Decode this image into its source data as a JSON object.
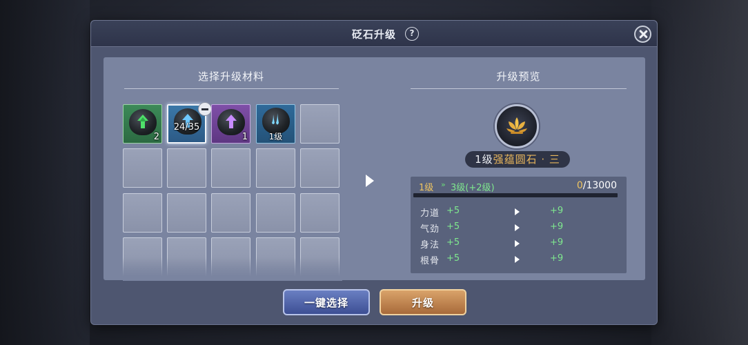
{
  "dialog": {
    "title": "砭石升级",
    "help_symbol": "?"
  },
  "left_section": {
    "title": "选择升级材料",
    "slots": [
      {
        "kind": "green",
        "count": "2"
      },
      {
        "kind": "blue",
        "center_text": "24/35",
        "selected": true
      },
      {
        "kind": "purple",
        "count": "1"
      },
      {
        "kind": "cyan",
        "bottom_text": "1级"
      }
    ]
  },
  "right_section": {
    "title": "升级预览",
    "stone": {
      "level": "1级",
      "name": "强蕴圆石 · 三",
      "icon": "lotus-icon"
    },
    "level_from": "1级",
    "level_arrow": "»",
    "level_to": "3级(+2级)",
    "exp_current": "0",
    "exp_total": "/13000",
    "exp_progress": 0,
    "stats": [
      {
        "name": "力道",
        "current": "+5",
        "next": "+9"
      },
      {
        "name": "气劲",
        "current": "+5",
        "next": "+9"
      },
      {
        "name": "身法",
        "current": "+5",
        "next": "+9"
      },
      {
        "name": "根骨",
        "current": "+5",
        "next": "+9"
      }
    ]
  },
  "buttons": {
    "auto_select": "一键选择",
    "upgrade": "升级"
  },
  "colors": {
    "accent_gold": "#e8b65c",
    "stat_green": "#7fe88e",
    "panel": "#4e5670"
  }
}
